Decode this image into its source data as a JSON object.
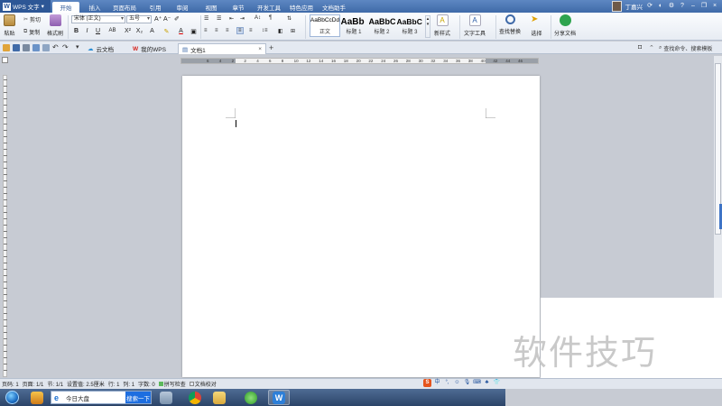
{
  "app": {
    "name": "WPS 文字",
    "logo_letter": "W"
  },
  "menu_tabs": [
    "开始",
    "插入",
    "页面布局",
    "引用",
    "审阅",
    "视图",
    "章节",
    "开发工具",
    "特色应用",
    "文档助手"
  ],
  "user": {
    "name": "丁嘉兴"
  },
  "ribbon": {
    "paste_label": "粘贴",
    "cut_label": "剪切",
    "copy_label": "复制",
    "format_painter_label": "格式刷",
    "font_name": "宋体 (正文)",
    "font_size": "五号",
    "styles": [
      {
        "preview": "AaBbCcDd",
        "name": "正文"
      },
      {
        "preview": "AaBb",
        "name": "标题 1"
      },
      {
        "preview": "AaBbC",
        "name": "标题 2"
      },
      {
        "preview": "AaBbC",
        "name": "标题 3"
      }
    ],
    "new_style_label": "新样式",
    "text_tools_label": "文字工具",
    "find_replace_label": "查找替换",
    "select_label": "选择",
    "share_label": "分享文档"
  },
  "tabs": [
    {
      "label": "云文档"
    },
    {
      "label": "我的WPS"
    },
    {
      "label": "文档1"
    }
  ],
  "search_command_placeholder": "查找命令、搜索模板",
  "ruler_numbers": [
    "6",
    "4",
    "2",
    "2",
    "4",
    "6",
    "8",
    "10",
    "12",
    "14",
    "16",
    "18",
    "20",
    "22",
    "24",
    "26",
    "28",
    "30",
    "32",
    "34",
    "36",
    "38",
    "40",
    "42",
    "44",
    "46"
  ],
  "status": {
    "page_num": "页码: 1",
    "pages": "页面: 1/1",
    "section": "节: 1/1",
    "setting": "设置值: 2.5厘米",
    "row": "行: 1",
    "col": "列: 1",
    "words": "字数: 0",
    "spell": "拼写检查",
    "doc_check": "文档校对"
  },
  "taskbar": {
    "search_text": "今日大盘",
    "search_button": "搜索一下"
  },
  "watermark": "软件技巧",
  "colors": {
    "accent": "#3f6aa8",
    "wps_red": "#d7261f",
    "ribbon_bg": "#eef2f7"
  }
}
